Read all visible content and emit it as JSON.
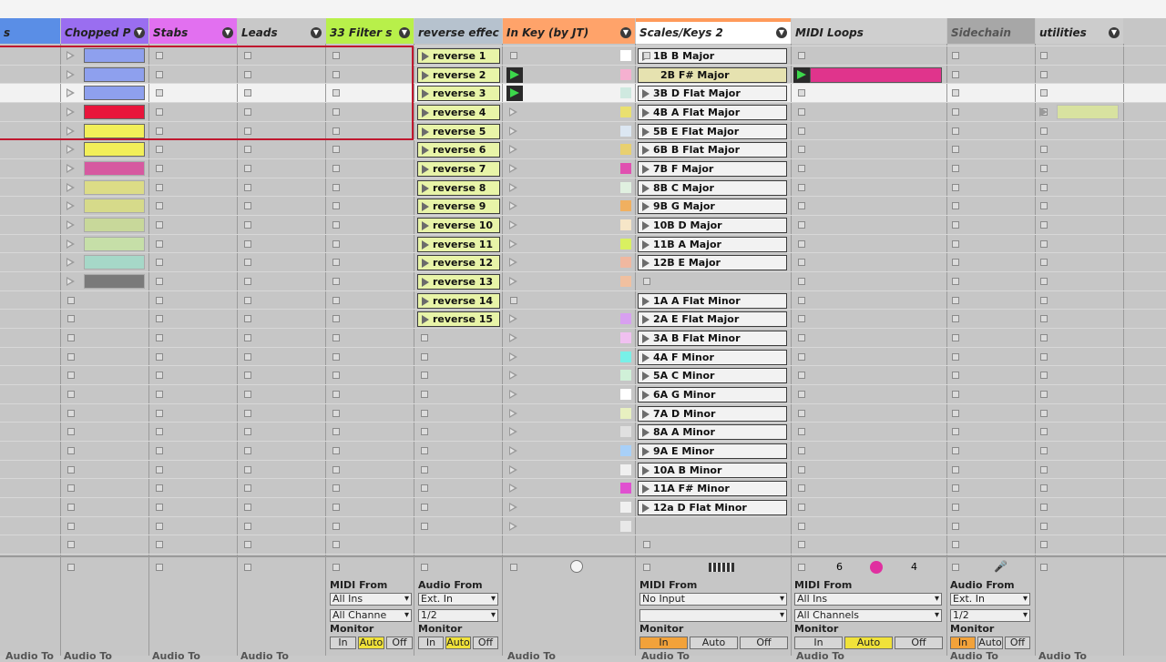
{
  "colors": {
    "selected_row": "#f2f2f2",
    "scene_box": "#c0182f",
    "play_active": "#3cd84b"
  },
  "headers": [
    {
      "label": "s",
      "color": "#5a8ee6",
      "has_arrow": false
    },
    {
      "label": "Chopped P",
      "color": "#9a6ef0",
      "has_arrow": true
    },
    {
      "label": "Stabs",
      "color": "#e270f0",
      "has_arrow": true
    },
    {
      "label": "Leads",
      "color": "#c8c8c8",
      "has_arrow": true
    },
    {
      "label": "33 Filter s",
      "color": "#b8f04a",
      "has_arrow": true
    },
    {
      "label": "reverse effec",
      "color": "#b6c2ce",
      "has_arrow": false
    },
    {
      "label": "In Key (by JT)",
      "color": "#ffa36a",
      "has_arrow": true
    },
    {
      "label": "Scales/Keys 2",
      "color": "#ffffff",
      "has_arrow": true
    },
    {
      "label": "MIDI Loops",
      "color": "#cfcfcf",
      "has_arrow": false
    },
    {
      "label": "Sidechain",
      "color": "#a7a7a7",
      "has_arrow": false
    },
    {
      "label": "utilities",
      "color": "#cccccc",
      "has_arrow": true
    }
  ],
  "chopped_clips": [
    {
      "color": "#8ea0ee"
    },
    {
      "color": "#8ea0ee"
    },
    {
      "color": "#8ea0ee"
    },
    {
      "color": "#e8153b"
    },
    {
      "color": "#f2ef59"
    },
    {
      "color": "#f2ef59"
    },
    {
      "color": "#d659a0"
    },
    {
      "color": "#dcdc86"
    },
    {
      "color": "#d6da8a"
    },
    {
      "color": "#c8d89a"
    },
    {
      "color": "#c6dfa8"
    },
    {
      "color": "#a6d8c8"
    },
    {
      "color": "#7a7a7a"
    }
  ],
  "reverse_clips": [
    "reverse 1",
    "reverse 2",
    "reverse 3",
    "reverse 4",
    "reverse 5",
    "reverse 6",
    "reverse 7",
    "reverse 8",
    "reverse 9",
    "reverse 10",
    "reverse 11",
    "reverse 12",
    "reverse 13",
    "reverse 14",
    "reverse 15"
  ],
  "scale_clips": [
    "1B B Major",
    "2B F# Major",
    "3B D Flat Major",
    "4B A Flat Major",
    "5B E Flat Major",
    "6B B Flat Major",
    "7B F Major",
    "8B C Major",
    "9B G Major",
    "10B D Major",
    "11B A Major",
    "12B E Major",
    "",
    "1A A Flat Minor",
    "2A E Flat Major",
    "3A B Flat Minor",
    "4A F Minor",
    "5A C Minor",
    "6A G Minor",
    "7A D Minor",
    "8A A Minor",
    "9A E Minor",
    "10A B Minor",
    "11A F# Minor",
    "12a D Flat Minor"
  ],
  "inkey_swatches": [
    "#ffffff",
    "#f5b0d0",
    "#cfe9e0",
    "#eae070",
    "#dce7f2",
    "#e8d070",
    "#e050b0",
    "#e0f0e0",
    "#f0b060",
    "#f6e6c8",
    "#d9f060",
    "#f0b8a0",
    "#f0c0a0",
    "",
    "#d8a0f0",
    "#f0c0f0",
    "#78f0e8",
    "#d0f0d8",
    "#ffffff",
    "#e8f0c0",
    "#e0e0e0",
    "#a8d0f8",
    "#f0f0f0",
    "#e050d0",
    "#f0f0f0",
    "#e8e8e8"
  ],
  "midi_loop_clip": {
    "color": "#e0348c"
  },
  "utilities_clip": {
    "color": "#d8e2a0"
  },
  "status_row": {
    "midi_loops_left": "6",
    "midi_loops_right": "4"
  },
  "io": {
    "midi_from": "MIDI From",
    "audio_from": "Audio From",
    "monitor": "Monitor",
    "in": "In",
    "auto": "Auto",
    "off": "Off",
    "audio_to": "Audio To",
    "filter": {
      "source": "All Ins",
      "channel": "All Channe"
    },
    "reverse": {
      "source": "Ext. In",
      "channel": "1/2"
    },
    "scales": {
      "source": "No Input",
      "channel": ""
    },
    "midiloops": {
      "source": "All Ins",
      "channel": "All Channels"
    },
    "sidechain": {
      "source": "Ext. In",
      "channel": "1/2"
    }
  }
}
